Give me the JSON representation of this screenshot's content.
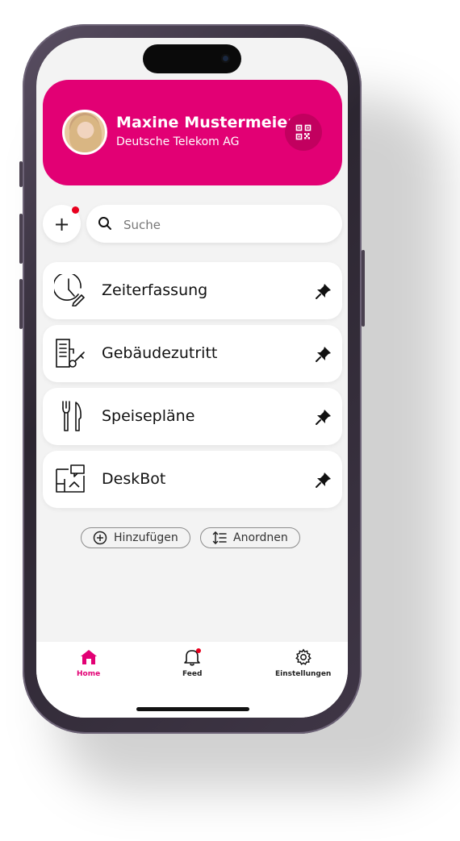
{
  "colors": {
    "brand": "#e20074",
    "badge": "#e8001e"
  },
  "profile": {
    "name": "Maxine Mustermeier",
    "company": "Deutsche Telekom AG",
    "avatar_icon": "avatar-photo",
    "qr_icon": "qr-code-icon"
  },
  "search": {
    "placeholder": "Suche"
  },
  "tiles": [
    {
      "label": "Zeiterfassung",
      "icon": "clock-pencil-icon"
    },
    {
      "label": "Gebäudezutritt",
      "icon": "building-key-icon"
    },
    {
      "label": "Speisepläne",
      "icon": "fork-knife-icon"
    },
    {
      "label": "DeskBot",
      "icon": "desk-chat-icon"
    }
  ],
  "actions": {
    "add_label": "Hinzufügen",
    "arrange_label": "Anordnen"
  },
  "tabbar": {
    "home": "Home",
    "feed": "Feed",
    "settings": "Einstellungen"
  }
}
